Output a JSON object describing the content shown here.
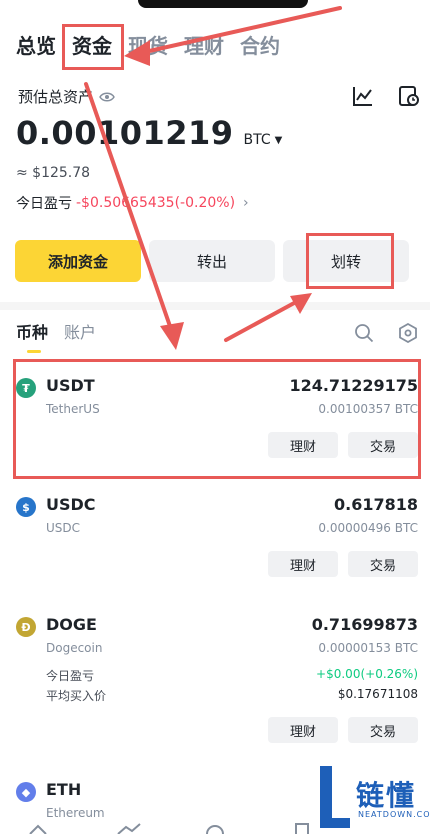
{
  "top_tabs": [
    "总览",
    "资金",
    "现货",
    "理财",
    "合约"
  ],
  "header": {
    "estimated_label": "预估总资产",
    "balance": "0.00101219",
    "balance_unit": "BTC",
    "usd_approx": "≈ $125.78",
    "pnl_label": "今日盈亏",
    "pnl_value": "-$0.50665435(-0.20%)"
  },
  "actions": {
    "add_funds": "添加资金",
    "withdraw": "转出",
    "transfer": "划转"
  },
  "sub_tabs": [
    "币种",
    "账户"
  ],
  "assets": [
    {
      "symbol": "USDT",
      "name": "TetherUS",
      "amount": "124.71229175",
      "btc": "0.00100357 BTC",
      "icon_color": "#26a17b",
      "icon_glyph": "₮"
    },
    {
      "symbol": "USDC",
      "name": "USDC",
      "amount": "0.617818",
      "btc": "0.00000496 BTC",
      "icon_color": "#2775ca",
      "icon_glyph": "$"
    },
    {
      "symbol": "DOGE",
      "name": "Dogecoin",
      "amount": "0.71699873",
      "btc": "0.00000153 BTC",
      "icon_color": "#c2a633",
      "icon_glyph": "Ð",
      "pnl_label": "今日盈亏",
      "pnl_value": "+$0.00(+0.26%)",
      "avg_label": "平均买入价",
      "avg_value": "$0.17671108"
    },
    {
      "symbol": "ETH",
      "name": "Ethereum",
      "icon_color": "#627eea",
      "icon_glyph": "◆"
    }
  ],
  "row_buttons": {
    "earn": "理财",
    "trade": "交易"
  },
  "watermark": {
    "brand": "链懂",
    "sub": "NEATDOWN.COM"
  },
  "colors": {
    "accent": "#fcd535",
    "negative": "#f6465d",
    "positive": "#0ecb81",
    "annotation": "#e85a57"
  }
}
